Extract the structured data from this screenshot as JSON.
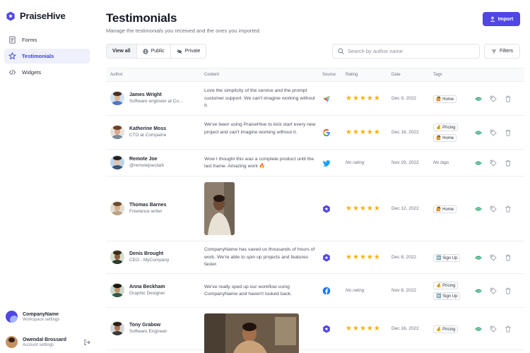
{
  "brand": {
    "name": "PraiseHive"
  },
  "nav": [
    {
      "label": "Forms",
      "icon": "form-icon",
      "active": false
    },
    {
      "label": "Testimonials",
      "icon": "star-icon",
      "active": true
    },
    {
      "label": "Widgets",
      "icon": "code-icon",
      "active": false
    }
  ],
  "workspace": {
    "name": "CompanyName",
    "sub": "Workspace settings"
  },
  "account": {
    "name": "Owendal Brossard",
    "sub": "Account settings"
  },
  "page": {
    "title": "Testimonials",
    "subtitle": "Manage the testimonials you received and the ones you imported.",
    "import_label": "Import"
  },
  "filters": {
    "segments": [
      "View all",
      "Public",
      "Private"
    ],
    "search_placeholder": "Search by author name",
    "filters_label": "Filters"
  },
  "columns": [
    "Author",
    "Content",
    "Source",
    "Rating",
    "Date",
    "Tags"
  ],
  "rows": [
    {
      "name": "James Wright",
      "role": "Software engineer at Co...",
      "content": "Love the simplicity of the service and the prompt customer support. We can't imagine working without it.",
      "source": "capterra",
      "rating": 5,
      "rating_text": "",
      "date": "Dec 9, 2022",
      "tags": [
        "🙋 Home"
      ]
    },
    {
      "name": "Katherine Moss",
      "role": "CTO at Compaine",
      "content": "We've been using PraiseHive to kick start every new project and can't imagine working without it.",
      "source": "google",
      "rating": 5,
      "rating_text": "",
      "date": "Dec 16, 2022",
      "tags": [
        "💰 Pricing",
        "🙋 Home"
      ]
    },
    {
      "name": "Remote Joe",
      "role": "@remotejoeclark",
      "content": "Wow I thought this was a complete product until the last frame. Amazing work 🔥",
      "source": "twitter",
      "rating": null,
      "rating_text": "No rating",
      "date": "Nov 29, 2022",
      "tags": [],
      "tags_empty": "No tags"
    },
    {
      "name": "Thomas Barnes",
      "role": "Freelance writer",
      "content": "",
      "source": "praisehive",
      "rating": 5,
      "rating_text": "",
      "date": "Dec 12, 2022",
      "tags": [
        "🙋 Home"
      ],
      "video": true
    },
    {
      "name": "Denis Brought",
      "role": "CEO - MyCompany",
      "content": "CompanyName has saved us thousands of hours of work. We're able to spin up projects and features faster.",
      "source": "praisehive",
      "rating": 5,
      "rating_text": "",
      "date": "Dec 8, 2022",
      "tags": [
        "🆕 Sign Up"
      ]
    },
    {
      "name": "Anna Beckham",
      "role": "Graphic Designer",
      "content": "We've really sped up our workflow using CompanyName and haven't looked back.",
      "source": "facebook",
      "rating": null,
      "rating_text": "No rating",
      "date": "Nov 8, 2022",
      "tags": [
        "💰 Pricing",
        "🆕 Sign Up"
      ]
    },
    {
      "name": "Tony Grabow",
      "role": "Software Engineer",
      "content": "",
      "source": "praisehive",
      "rating": 5,
      "rating_text": "",
      "date": "Dec 16, 2022",
      "tags": [
        "💰 Pricing"
      ],
      "video": true
    }
  ]
}
